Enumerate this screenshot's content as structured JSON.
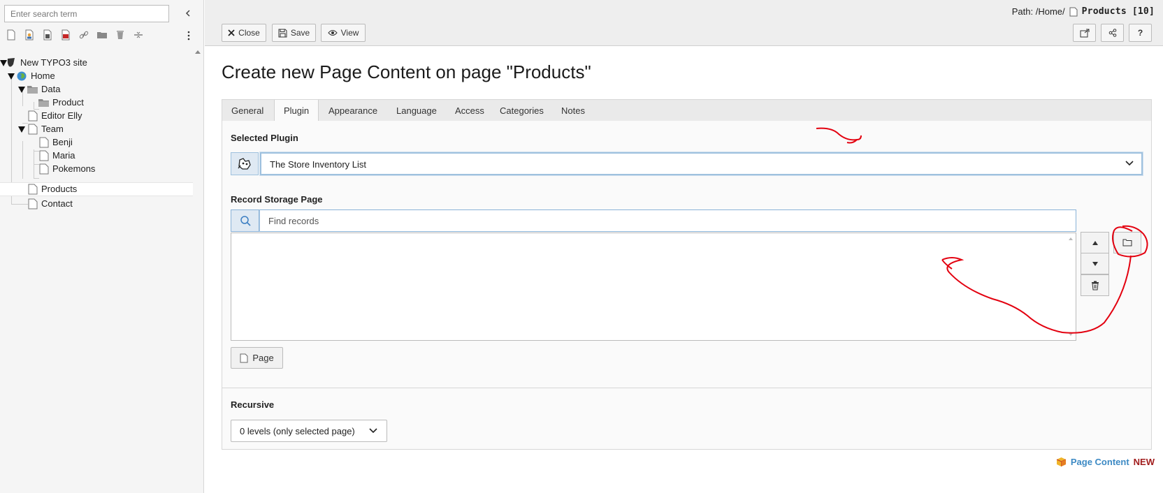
{
  "tree": {
    "search_placeholder": "Enter search term",
    "toolbar_icons": [
      "new-page-icon",
      "new-page-user-icon",
      "page-copy-icon",
      "page-cut-icon",
      "link-icon",
      "folder-icon",
      "trash-icon",
      "divider-icon"
    ],
    "nodes": [
      {
        "label": "New TYPO3 site",
        "icon": "typo3-logo-icon"
      },
      {
        "label": "Home",
        "icon": "globe-icon"
      },
      {
        "label": "Data",
        "icon": "folder-icon"
      },
      {
        "label": "Product",
        "icon": "folder-icon"
      },
      {
        "label": "Editor Elly",
        "icon": "page-icon"
      },
      {
        "label": "Team",
        "icon": "page-icon"
      },
      {
        "label": "Benji",
        "icon": "page-icon"
      },
      {
        "label": "Maria",
        "icon": "page-icon"
      },
      {
        "label": "Pokemons",
        "icon": "page-icon"
      },
      {
        "label": "Products",
        "icon": "page-icon",
        "selected": true
      },
      {
        "label": "Contact",
        "icon": "page-icon"
      }
    ]
  },
  "header": {
    "path_prefix": "Path: /Home/",
    "path_current": "Products [10]",
    "buttons": {
      "close": "Close",
      "save": "Save",
      "view": "View"
    },
    "right_icons": [
      "open-new-window-icon",
      "share-icon",
      "help-icon"
    ],
    "help_label": "?"
  },
  "main": {
    "title": "Create new Page Content on page \"Products\"",
    "tabs": [
      "General",
      "Plugin",
      "Appearance",
      "Language",
      "Access",
      "Categories",
      "Notes"
    ],
    "active_tab": "Plugin",
    "selected_plugin": {
      "label": "Selected Plugin",
      "value": "The Store Inventory List"
    },
    "record_storage": {
      "label": "Record Storage Page",
      "placeholder": "Find records",
      "page_button": "Page"
    },
    "recursive": {
      "label": "Recursive",
      "value": "0 levels (only selected page)"
    }
  },
  "footer": {
    "record_type": "Page Content",
    "status": "NEW"
  },
  "colors": {
    "accent": "#1f73b7",
    "annotation": "#e3000f",
    "new_status": "#c00000",
    "tab_bar": "#eaeaea"
  }
}
